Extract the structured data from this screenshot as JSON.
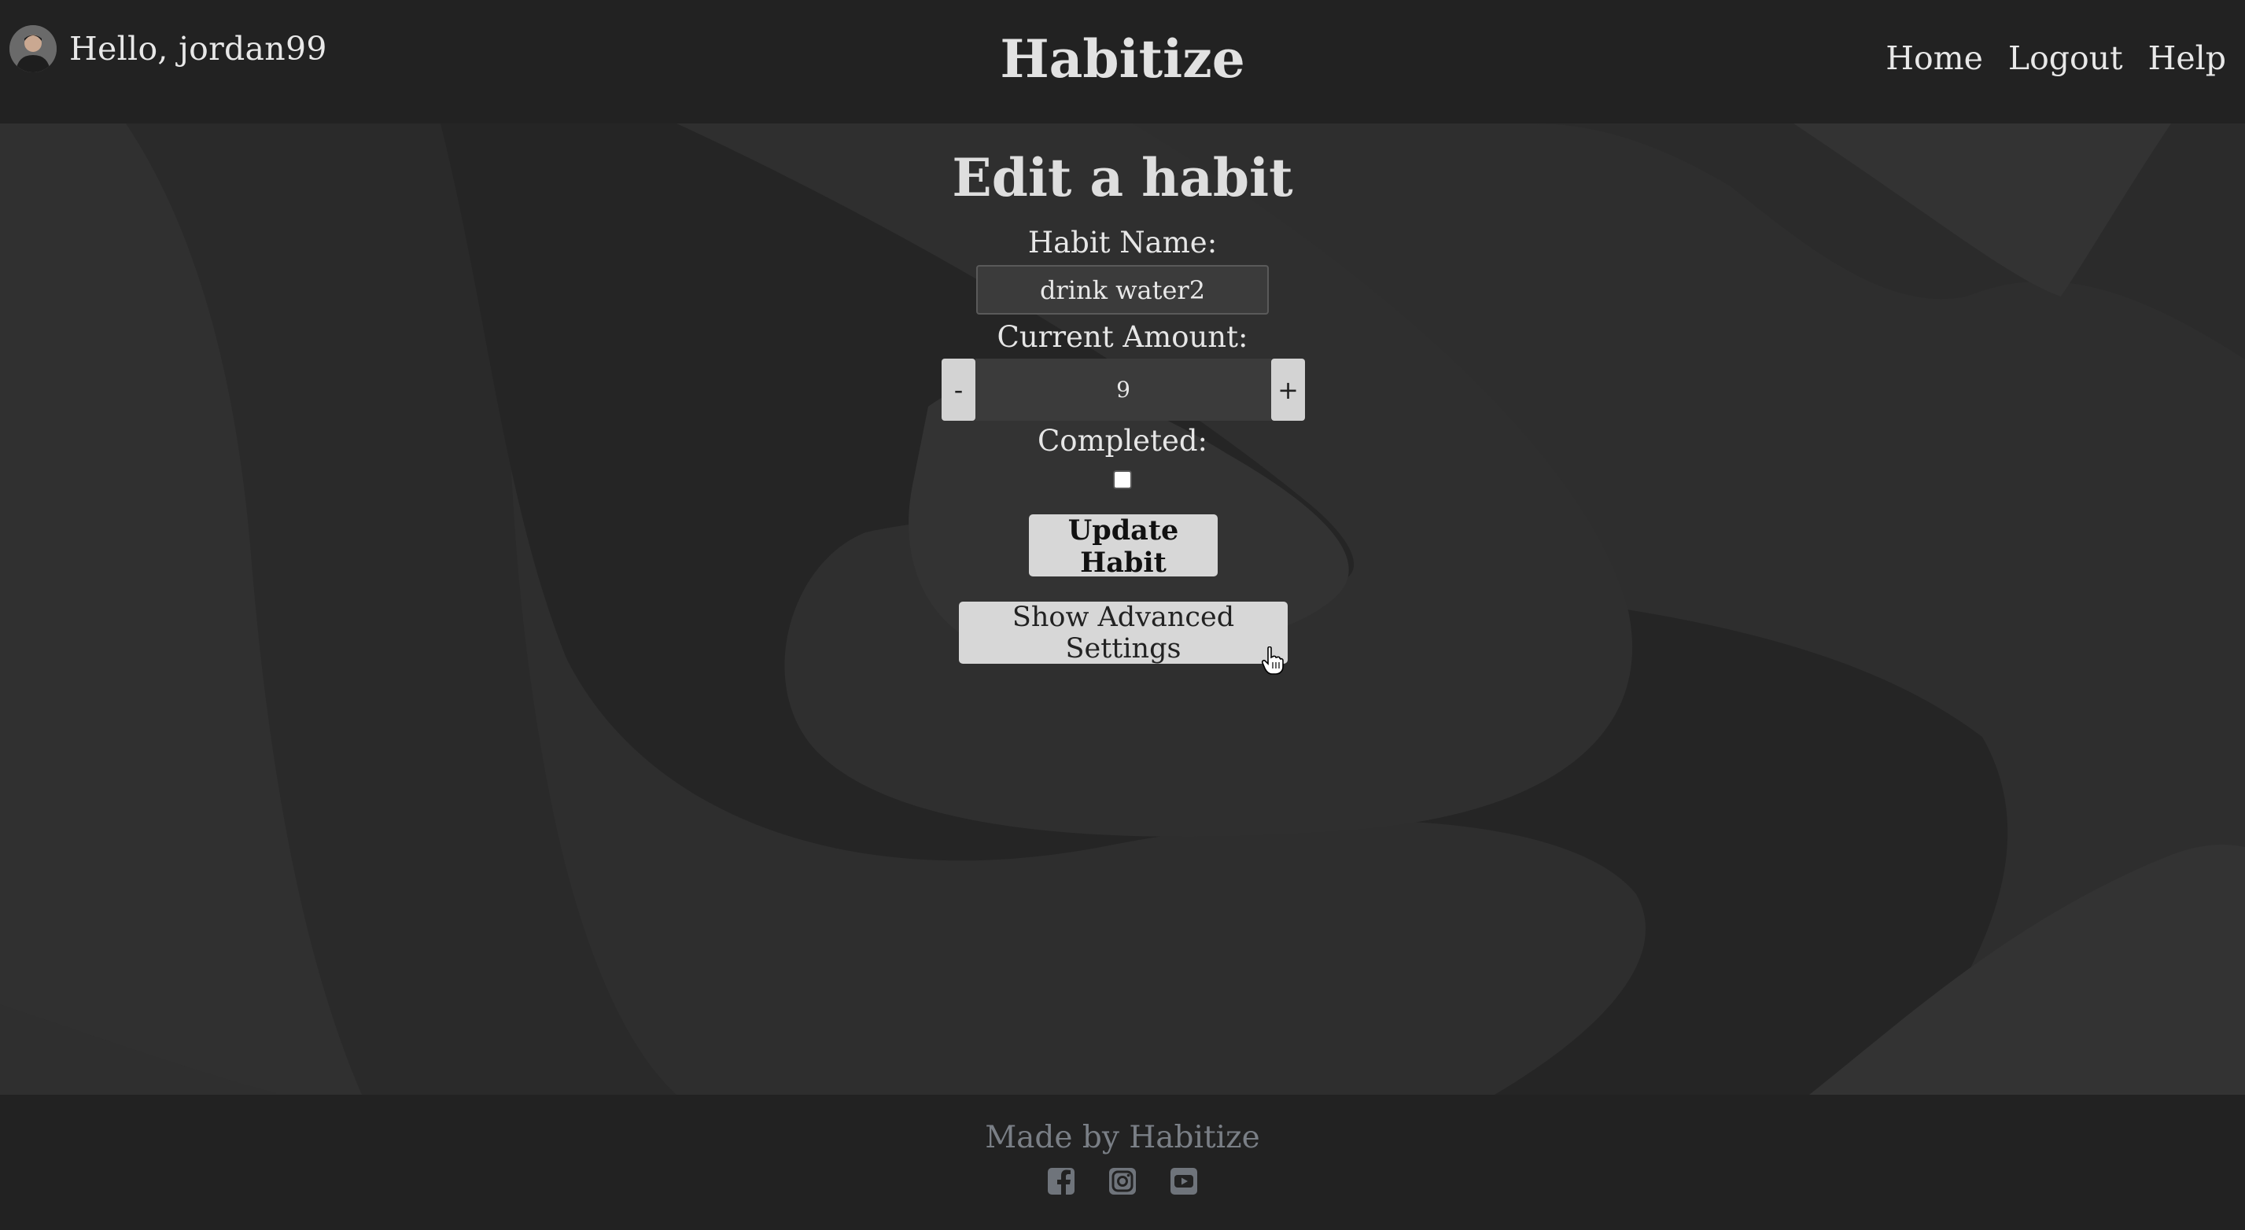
{
  "header": {
    "greeting": "Hello, jordan99",
    "brand": "Habitize",
    "nav": [
      "Home",
      "Logout",
      "Help"
    ]
  },
  "form": {
    "title": "Edit a habit",
    "name_label": "Habit Name:",
    "name_value": "drink water2",
    "amount_label": "Current Amount:",
    "amount_value": "9",
    "decrement_label": "-",
    "increment_label": "+",
    "completed_label": "Completed:",
    "completed": false,
    "update_button": "Update Habit",
    "advanced_button": "Show Advanced Settings"
  },
  "footer": {
    "made_by": "Made by Habitize",
    "socials": [
      "facebook-icon",
      "instagram-icon",
      "youtube-icon"
    ]
  },
  "colors": {
    "header_bg": "#222222",
    "page_bg": "#2a2a2a",
    "button_bg": "#d7d7d7",
    "footer_text": "#7a7f86"
  }
}
